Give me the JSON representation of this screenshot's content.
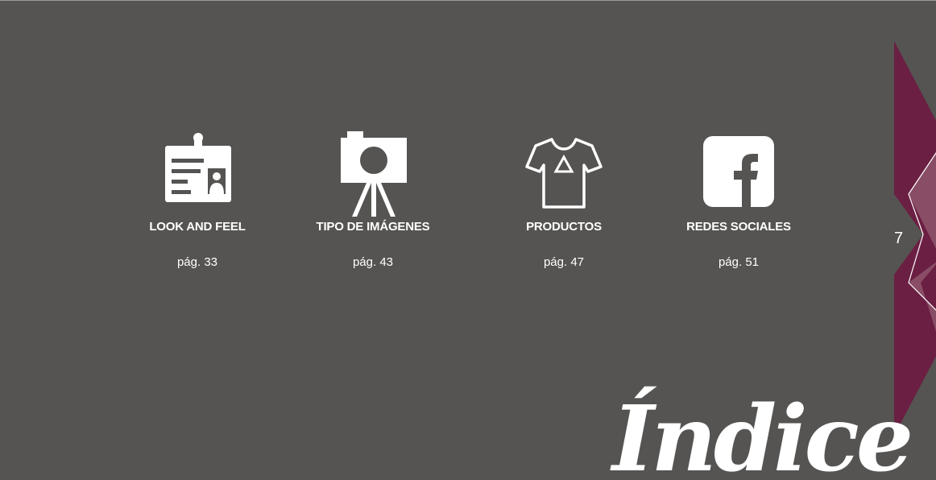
{
  "colors": {
    "background": "#555452",
    "ribbon_dark": "#6b1f42",
    "ribbon_light": "#8a4d66",
    "text": "#ffffff"
  },
  "items": [
    {
      "icon": "id-badge-icon",
      "label": "LOOK AND FEEL",
      "page": "pág. 33"
    },
    {
      "icon": "camera-tripod-icon",
      "label": "TIPO DE IMÁGENES",
      "page": "pág. 43"
    },
    {
      "icon": "tshirt-icon",
      "label": "PRODUCTOS",
      "page": "pág. 47"
    },
    {
      "icon": "facebook-icon",
      "label": "REDES SOCIALES",
      "page": "pág. 51"
    }
  ],
  "page_number": "7",
  "title": "Índice"
}
